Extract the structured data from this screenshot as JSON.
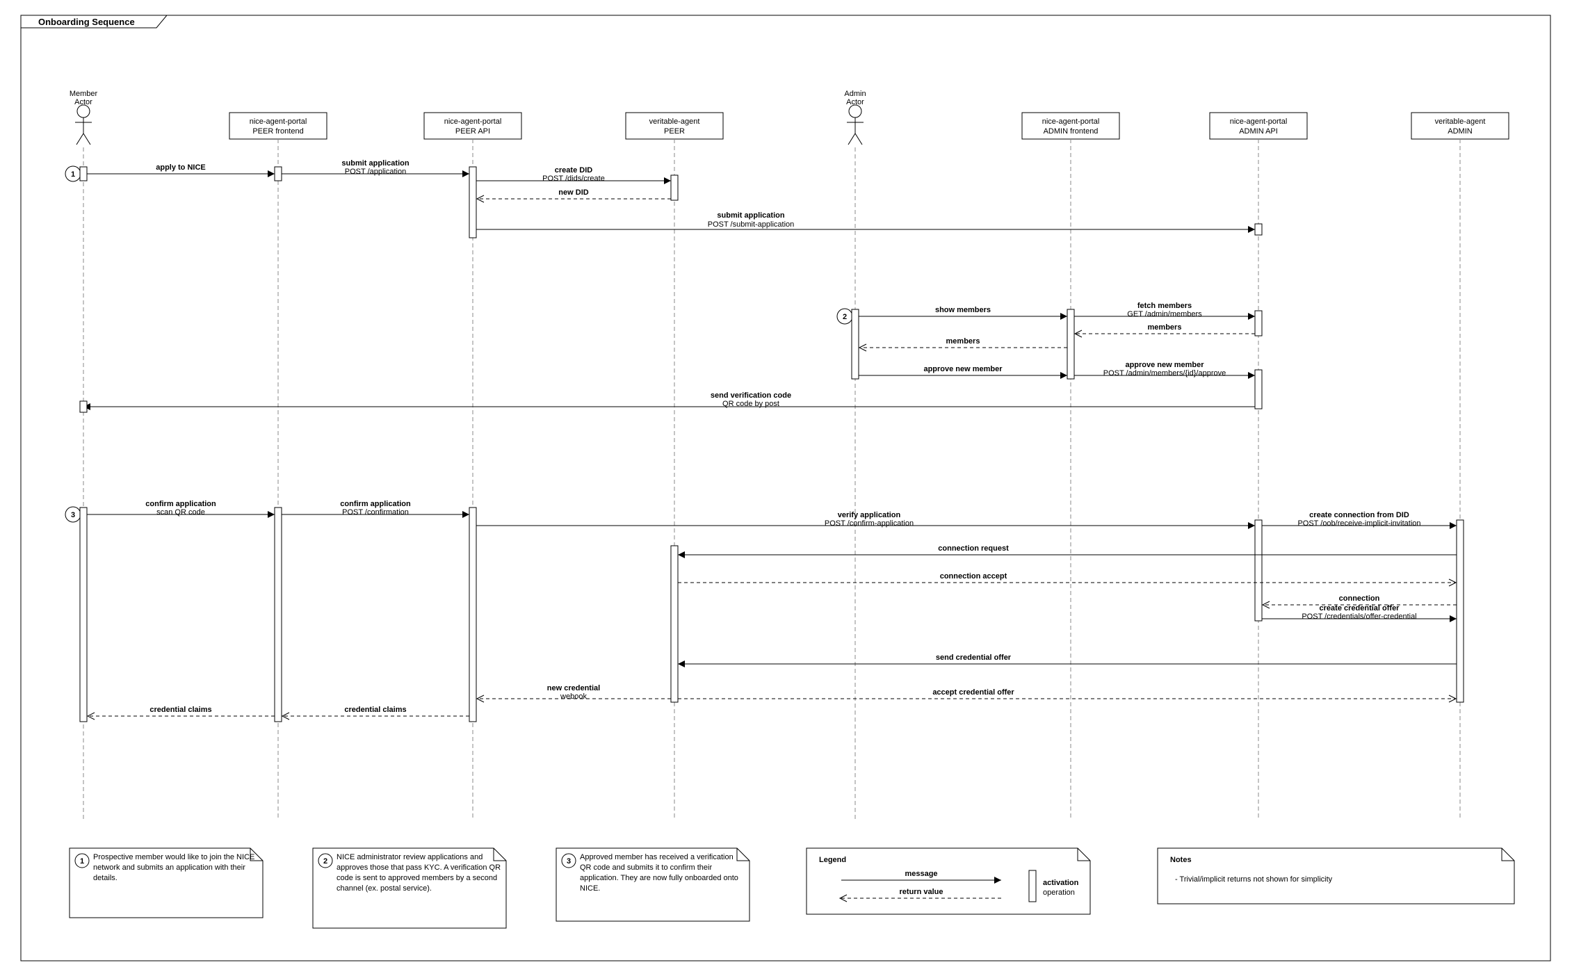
{
  "frame": {
    "title": "Onboarding Sequence"
  },
  "lanes": {
    "member": {
      "line1": "Member",
      "line2": "Actor"
    },
    "peerFE": {
      "line1": "nice-agent-portal",
      "line2": "PEER frontend"
    },
    "peerAPI": {
      "line1": "nice-agent-portal",
      "line2": "PEER API"
    },
    "peerAgent": {
      "line1": "veritable-agent",
      "line2": "PEER"
    },
    "admin": {
      "line1": "Admin",
      "line2": "Actor"
    },
    "adminFE": {
      "line1": "nice-agent-portal",
      "line2": "ADMIN frontend"
    },
    "adminAPI": {
      "line1": "nice-agent-portal",
      "line2": "ADMIN API"
    },
    "adminAgent": {
      "line1": "veritable-agent",
      "line2": "ADMIN"
    }
  },
  "msg": {
    "applyToNice": "apply to NICE",
    "submitApp": {
      "t": "submit application",
      "s": "POST /application"
    },
    "createDid": {
      "t": "create DID",
      "s": "POST /dids/create"
    },
    "newDid": "new DID",
    "submitApp2": {
      "t": "submit application",
      "s": "POST /submit-application"
    },
    "showMembers": "show members",
    "fetchMembers": {
      "t": "fetch members",
      "s": "GET /admin/members"
    },
    "members": "members",
    "approveNew": "approve new member",
    "approveCall": {
      "t": "approve new member",
      "s": "POST /admin/members/{id}/approve"
    },
    "sendVerif": {
      "t": "send verification code",
      "s": "QR code by post"
    },
    "confirmApp": {
      "t": "confirm application",
      "s": "scan QR code"
    },
    "confirmApp2": {
      "t": "confirm application",
      "s": "POST /confirmation"
    },
    "verifyApp": {
      "t": "verify application",
      "s": "POST /confirm-application"
    },
    "createConn": {
      "t": "create connection from DID",
      "s": "POST /oob/receive-implicit-invitation"
    },
    "connReq": "connection request",
    "connAcc": "connection accept",
    "connection": "connection",
    "credOffer": {
      "t": "create credential offer",
      "s": "POST /credentials/offer-credential"
    },
    "sendOffer": "send credential offer",
    "acceptOffer": "accept credential offer",
    "newCred": {
      "t": "new credential",
      "s": "webook"
    },
    "credClaims": "credential claims"
  },
  "notes": {
    "n1": "Prospective member would like to join the NICE network and submits an application with their details.",
    "n2": "NICE administrator review applications and approves those that pass KYC. A verification QR code is sent to approved members by a second channel (ex. postal service).",
    "n3": "Approved member has received a verification QR code and submits it to confirm their application. They are now fully onboarded onto NICE.",
    "legend": {
      "title": "Legend",
      "message": "message",
      "retval": "return value",
      "activation": "activation",
      "operation": "operation"
    },
    "notesBox": {
      "title": "Notes",
      "line": "- Trivial/implicit returns not shown for simplicity"
    }
  },
  "circles": {
    "c1": "1",
    "c2": "2",
    "c3": "3"
  }
}
